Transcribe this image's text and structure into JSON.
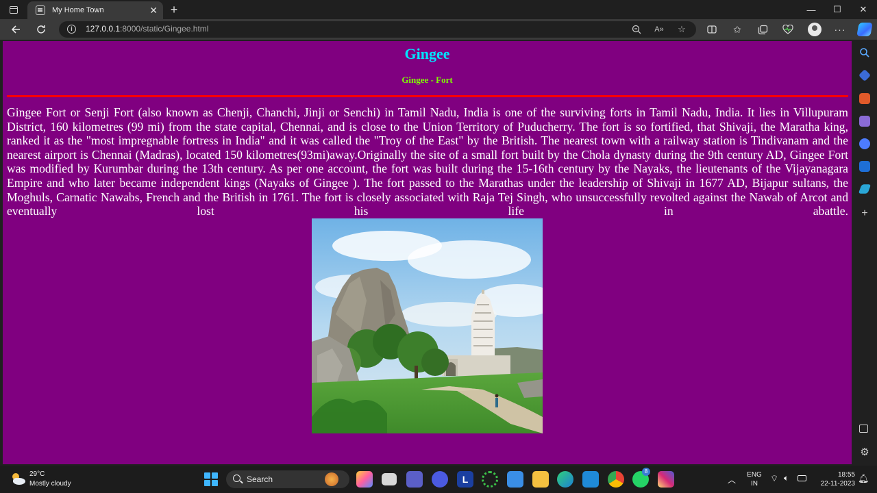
{
  "browser": {
    "tab_title": "My Home Town",
    "tab_close": "✕",
    "new_tab": "+",
    "url_host": "127.0.0.1",
    "url_rest": ":8000/static/Gingee.html",
    "window_controls": {
      "minimize": "—",
      "maximize": "☐",
      "close": "✕"
    }
  },
  "page": {
    "title": "Gingee",
    "subtitle": "Gingee - Fort",
    "paragraph": "Gingee Fort or Senji Fort (also known as Chenji, Chanchi, Jinji or Senchi) in Tamil Nadu, India is one of the surviving forts in Tamil Nadu, India. It lies in Villupuram District, 160 kilometres (99 mi) from the state capital, Chennai, and is close to the Union Territory of Puducherry. The fort is so fortified, that Shivaji, the Maratha king, ranked it as the \"most impregnable fortress in India\" and it was called the \"Troy of the East\" by the British. The nearest town with a railway station is Tindivanam and the nearest airport is Chennai (Madras), located 150 kilometres(93mi)away.Originally the site of a small fort built by the Chola dynasty during the 9th century AD, Gingee Fort was modified by Kurumbar during the 13th century. As per one account, the fort was built during the 15-16th century by the Nayaks, the lieutenants of the Vijayanagara Empire and who later became independent kings (Nayaks of Gingee ). The fort passed to the Marathas under the leadership of Shivaji in 1677 AD, Bijapur sultans, the Moghuls, Carnatic Nawabs, French and the British in 1761. The fort is closely associated with Raja Tej Singh, who unsuccessfully revolted against the Nawab of Arcot and eventually lost his life in abattle.",
    "colors": {
      "background": "#800080",
      "title": "#00e5ff",
      "subtitle": "#7fff00",
      "rule": "#ff0000",
      "text": "#ffffff"
    }
  },
  "taskbar": {
    "weather_temp": "29°C",
    "weather_desc": "Mostly cloudy",
    "search_label": "Search",
    "lang_top": "ENG",
    "lang_bottom": "IN",
    "time": "18:55",
    "date": "22-11-2023",
    "whatsapp_badge": "8",
    "l_app_letter": "L"
  }
}
